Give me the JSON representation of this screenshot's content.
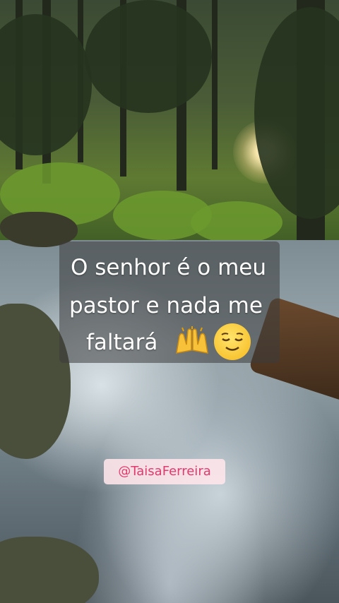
{
  "overlay": {
    "caption_lines": [
      "O senhor é o meu",
      "pastor e nada me",
      "faltará"
    ],
    "emojis": [
      "praise-hands-icon",
      "relieved-face-icon"
    ],
    "handle": "@TaisaFerreira",
    "handle_color": "#e23a6e"
  }
}
